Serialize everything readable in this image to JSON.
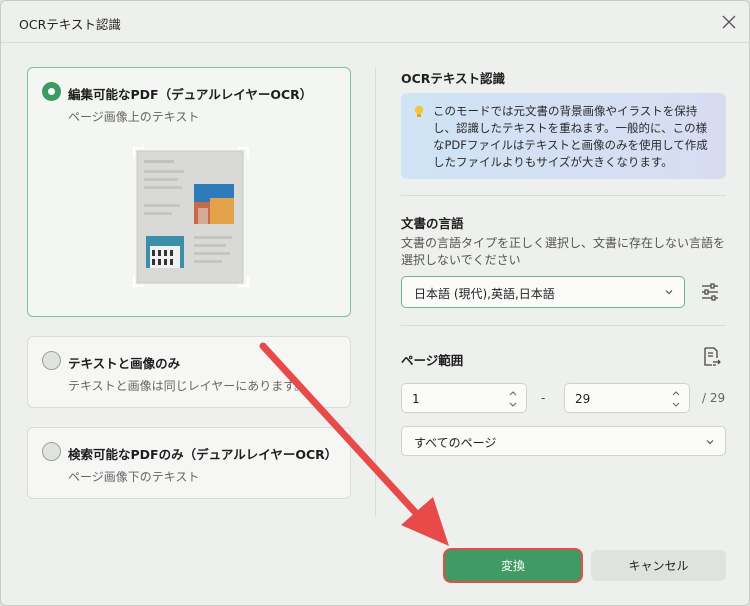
{
  "dialog": {
    "title": "OCRテキスト認識"
  },
  "options": [
    {
      "title": "編集可能なPDF（デュアルレイヤーOCR）",
      "desc": "ページ画像上のテキスト",
      "selected": true
    },
    {
      "title": "テキストと画像のみ",
      "desc": "テキストと画像は同じレイヤーにあります。",
      "selected": false
    },
    {
      "title": "検索可能なPDFのみ（デュアルレイヤーOCR）",
      "desc": "ページ画像下のテキスト",
      "selected": false
    }
  ],
  "ocr_section": {
    "title": "OCRテキスト認識",
    "info": "このモードでは元文書の背景画像やイラストを保持し、認識したテキストを重ねます。一般的に、この様なPDFファイルはテキストと画像のみを使用して作成したファイルよりもサイズが大きくなります。"
  },
  "language_section": {
    "title": "文書の言語",
    "hint": "文書の言語タイプを正しく選択し、文書に存在しない言語を選択しないでください",
    "selected": "日本語 (現代),英語,日本語"
  },
  "range_section": {
    "title": "ページ範囲",
    "from": "1",
    "to": "29",
    "dash": "-",
    "total": "/ 29",
    "pages_select": "すべてのページ"
  },
  "buttons": {
    "convert": "変換",
    "cancel": "キャンセル"
  },
  "colors": {
    "accent": "#3f9a64",
    "highlight": "#e24d4d"
  }
}
